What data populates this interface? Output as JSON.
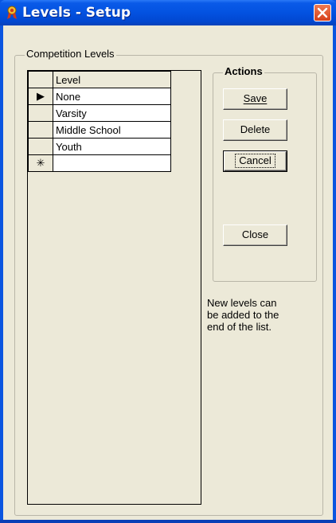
{
  "window": {
    "title": "Levels - Setup"
  },
  "competition_levels": {
    "group_label": "Competition Levels",
    "grid": {
      "column_header": "Level",
      "rows": [
        {
          "indicator": "▶",
          "value": "None"
        },
        {
          "indicator": "",
          "value": "Varsity"
        },
        {
          "indicator": "",
          "value": "Middle School"
        },
        {
          "indicator": "",
          "value": "Youth"
        },
        {
          "indicator": "✳",
          "value": ""
        }
      ]
    }
  },
  "actions": {
    "group_label": "Actions",
    "save_label": "Save",
    "delete_label": "Delete",
    "cancel_label": "Cancel",
    "close_label": "Close"
  },
  "note": "New levels can be added to the end of the list."
}
